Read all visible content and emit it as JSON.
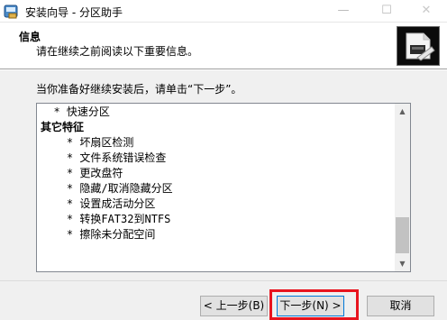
{
  "window": {
    "title": "安装向导 - 分区助手",
    "minimize_glyph": "—",
    "maximize_glyph": "☐",
    "close_glyph": "✕"
  },
  "header": {
    "title": "信息",
    "subtitle": "请在继续之前阅读以下重要信息。"
  },
  "content": {
    "prompt": "当你准备好继续安装后，请单击“下一步”。",
    "memo_lines": [
      "  * 快速分区",
      "其它特征",
      "    * 坏扇区检测",
      "    * 文件系统错误检查",
      "    * 更改盘符",
      "    * 隐藏/取消隐藏分区",
      "    * 设置成活动分区",
      "    * 转换FAT32到NTFS",
      "    * 擦除未分配空间",
      "",
      ""
    ],
    "bold_line_index": 1,
    "scroll_up_glyph": "▲",
    "scroll_down_glyph": "▼"
  },
  "buttons": {
    "back": "< 上一步(B)",
    "next": "下一步(N) >",
    "cancel": "取消"
  },
  "colors": {
    "highlight": "#e8141e",
    "default_button_border": "#0078d7"
  }
}
